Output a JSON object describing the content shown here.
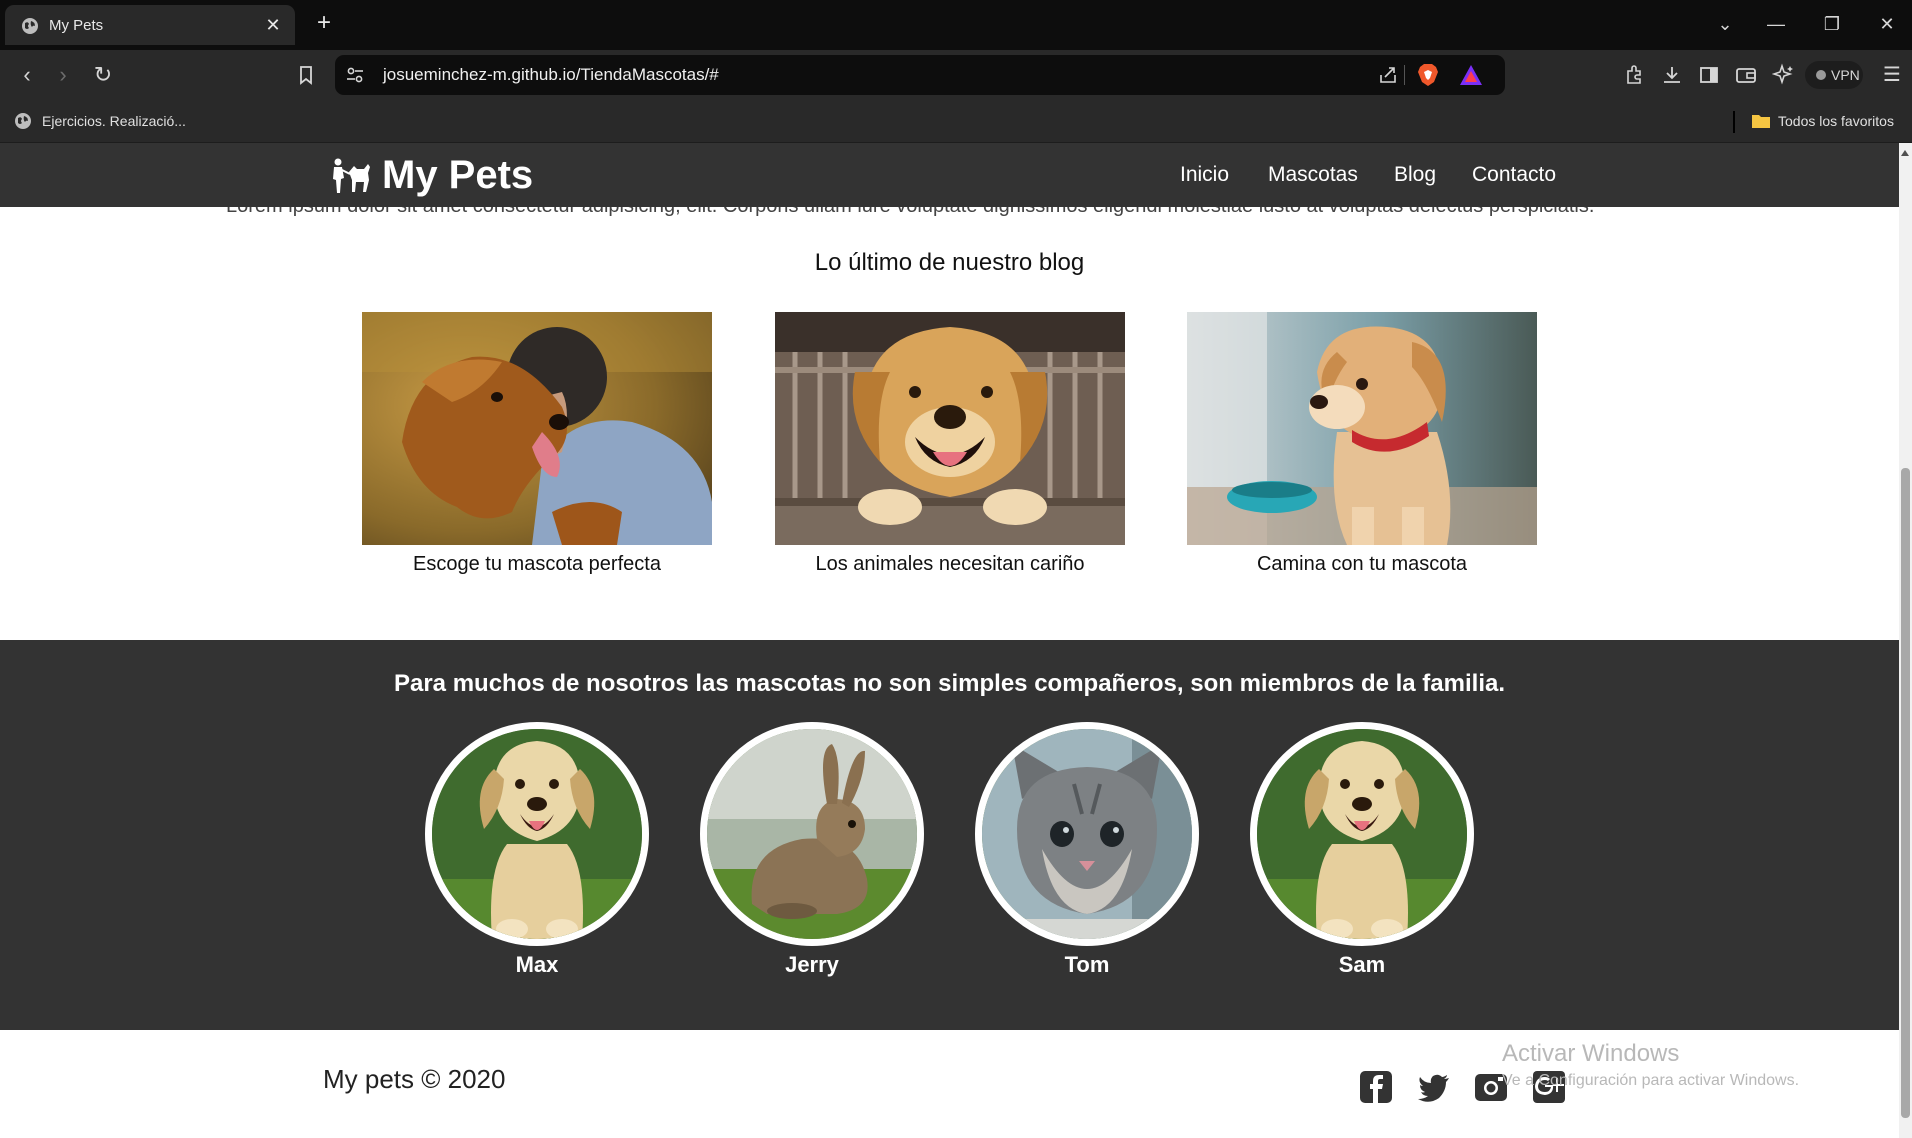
{
  "browser": {
    "tab": {
      "title": "My Pets"
    },
    "new_tab": "+",
    "url": "josueminchez-m.github.io/TiendaMascotas/#",
    "vpn_label": "VPN",
    "bookmarks": [
      {
        "label": "Ejercicios. Realizació..."
      }
    ],
    "all_bookmarks": "Todos los favoritos"
  },
  "site": {
    "brand": "My Pets",
    "nav": [
      "Inicio",
      "Mascotas",
      "Blog",
      "Contacto"
    ],
    "lorem_text": "Lorem ipsum dolor sit amet consectetur adipisicing, elit. Corporis ullam iure voluptate dignissimos eligendi molestiae iusto at voluptas delectus perspiciatis.",
    "blog_heading": "Lo último de nuestro blog",
    "blog_posts": [
      {
        "title": "Escoge tu mascota perfecta"
      },
      {
        "title": "Los animales necesitan cariño"
      },
      {
        "title": "Camina con tu mascota"
      }
    ],
    "pets_heading": "Para muchos de nosotros las mascotas no son simples compañeros, son miembros de la familia.",
    "pets": [
      {
        "name": "Max"
      },
      {
        "name": "Jerry"
      },
      {
        "name": "Tom"
      },
      {
        "name": "Sam"
      }
    ],
    "footer": {
      "copyright": "My pets © 2020"
    },
    "social": [
      "facebook-icon",
      "twitter-icon",
      "instagram-icon",
      "google-plus-icon"
    ]
  },
  "os_watermark": {
    "title": "Activar Windows",
    "subtitle": "Ve a Configuración para activar Windows."
  },
  "colors": {
    "header_bg": "#333333",
    "band_bg": "#333333",
    "chrome_bg": "#292929",
    "tabstrip_bg": "#0d0d0d"
  }
}
